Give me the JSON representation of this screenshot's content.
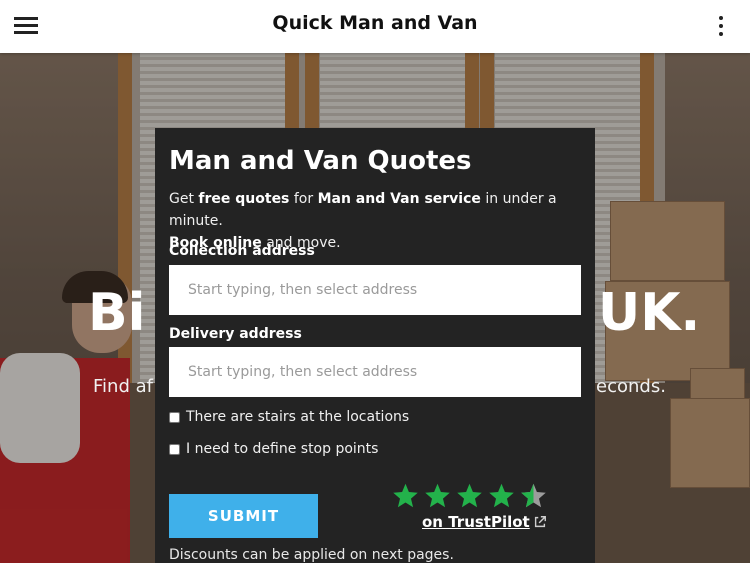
{
  "app": {
    "title": "Quick Man and Van"
  },
  "hero": {
    "heading_left": "Bi",
    "heading_right": "UK.",
    "subtitle_left": "Find af",
    "subtitle_right": "econds."
  },
  "quote_form": {
    "title": "Man and Van Quotes",
    "intro": {
      "t1": "Get ",
      "b1": "free quotes",
      "t2": " for ",
      "b2": "Man and Van service",
      "t3": " in under a minute. ",
      "b3": "Book online",
      "t4": " and move."
    },
    "collection_label": "Collection address",
    "collection_placeholder": "Start typing, then select address",
    "delivery_label": "Delivery address",
    "delivery_placeholder": "Start typing, then select address",
    "stairs_label": "There are stairs at the locations",
    "stops_label": "I need to define stop points",
    "submit_label": "SUBMIT",
    "trustpilot_label": "on TrustPilot",
    "rating_stars": 4.5,
    "discount_note": "Discounts can be applied on next pages."
  },
  "colors": {
    "card_bg": "#232323",
    "submit_bg": "#3fb0ea",
    "star_green": "#23b24b",
    "star_gray": "#9c9c9c"
  },
  "icons": {
    "menu": "hamburger-menu-icon",
    "more": "vertical-dots-icon",
    "external": "external-link-icon",
    "star": "star-icon"
  }
}
